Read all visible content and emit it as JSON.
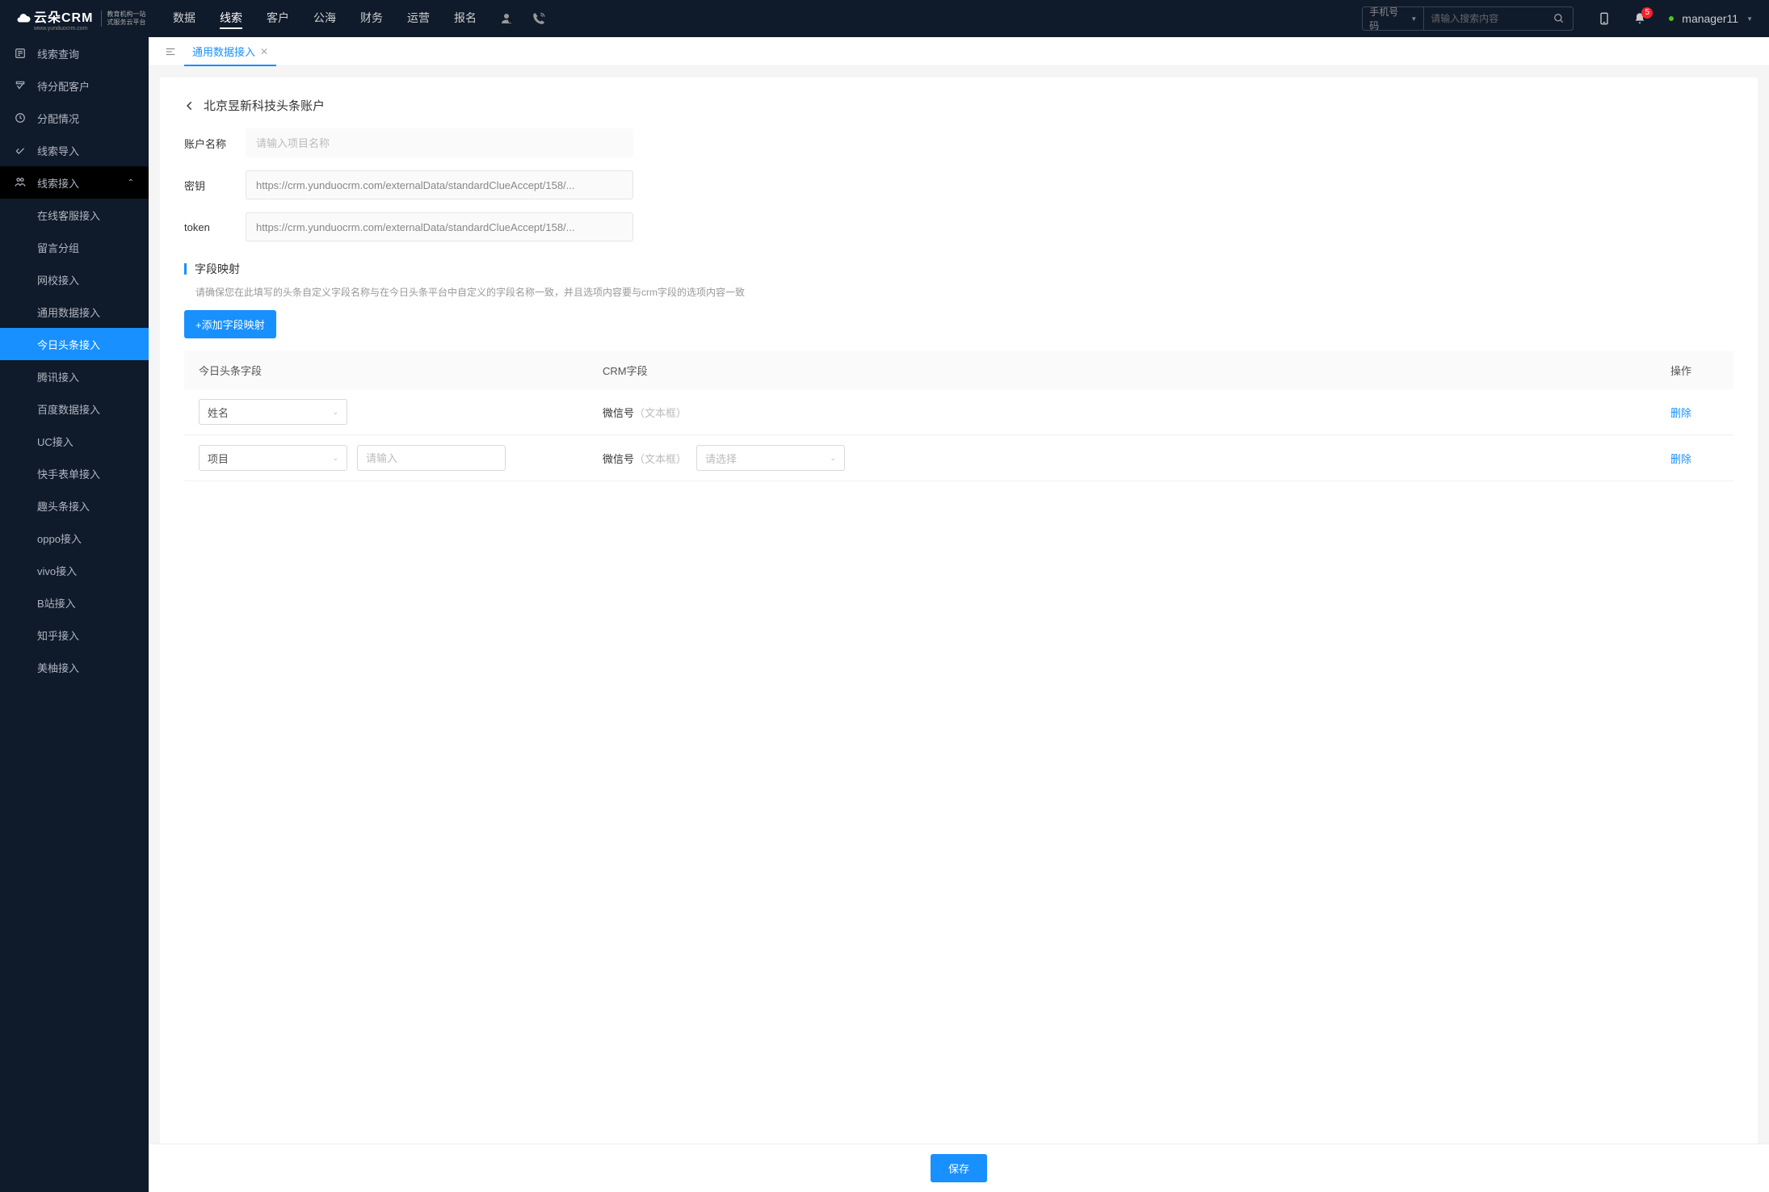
{
  "logo": {
    "brand": "云朵CRM",
    "sub_line1": "教育机构一站",
    "sub_line2": "式服务云平台",
    "url": "www.yunduocrm.com"
  },
  "nav": [
    "数据",
    "线索",
    "客户",
    "公海",
    "财务",
    "运营",
    "报名"
  ],
  "nav_active": "线索",
  "search": {
    "select": "手机号码",
    "placeholder": "请输入搜索内容"
  },
  "notification_count": "5",
  "user": "manager11",
  "sidebar": {
    "items": [
      {
        "label": "线索查询"
      },
      {
        "label": "待分配客户"
      },
      {
        "label": "分配情况"
      },
      {
        "label": "线索导入"
      },
      {
        "label": "线索接入",
        "expanded": true,
        "children": [
          "在线客服接入",
          "留言分组",
          "网校接入",
          "通用数据接入",
          "今日头条接入",
          "腾讯接入",
          "百度数据接入",
          "UC接入",
          "快手表单接入",
          "趣头条接入",
          "oppo接入",
          "vivo接入",
          "B站接入",
          "知乎接入",
          "美柚接入"
        ],
        "active_child": "今日头条接入"
      }
    ]
  },
  "tabs": [
    {
      "label": "通用数据接入",
      "active": true
    }
  ],
  "breadcrumb": "北京昱新科技头条账户",
  "form": {
    "account_label": "账户名称",
    "account_placeholder": "请输入项目名称",
    "secret_label": "密钥",
    "secret_value": "https://crm.yunduocrm.com/externalData/standardClueAccept/158/...",
    "token_label": "token",
    "token_value": "https://crm.yunduocrm.com/externalData/standardClueAccept/158/..."
  },
  "section": {
    "title": "字段映射",
    "desc": "请确保您在此填写的头条自定义字段名称与在今日头条平台中自定义的字段名称一致，并且选项内容要与crm字段的选项内容一致",
    "add_btn": "+添加字段映射"
  },
  "table": {
    "headers": [
      "今日头条字段",
      "CRM字段",
      "操作"
    ],
    "rows": [
      {
        "field": "姓名",
        "crm": "微信号",
        "crm_type": "（文本框）",
        "extra_input": null,
        "extra_select": null
      },
      {
        "field": "项目",
        "crm": "微信号",
        "crm_type": "（文本框）",
        "extra_input_placeholder": "请输入",
        "extra_select_placeholder": "请选择"
      }
    ],
    "delete": "删除"
  },
  "save_btn": "保存"
}
